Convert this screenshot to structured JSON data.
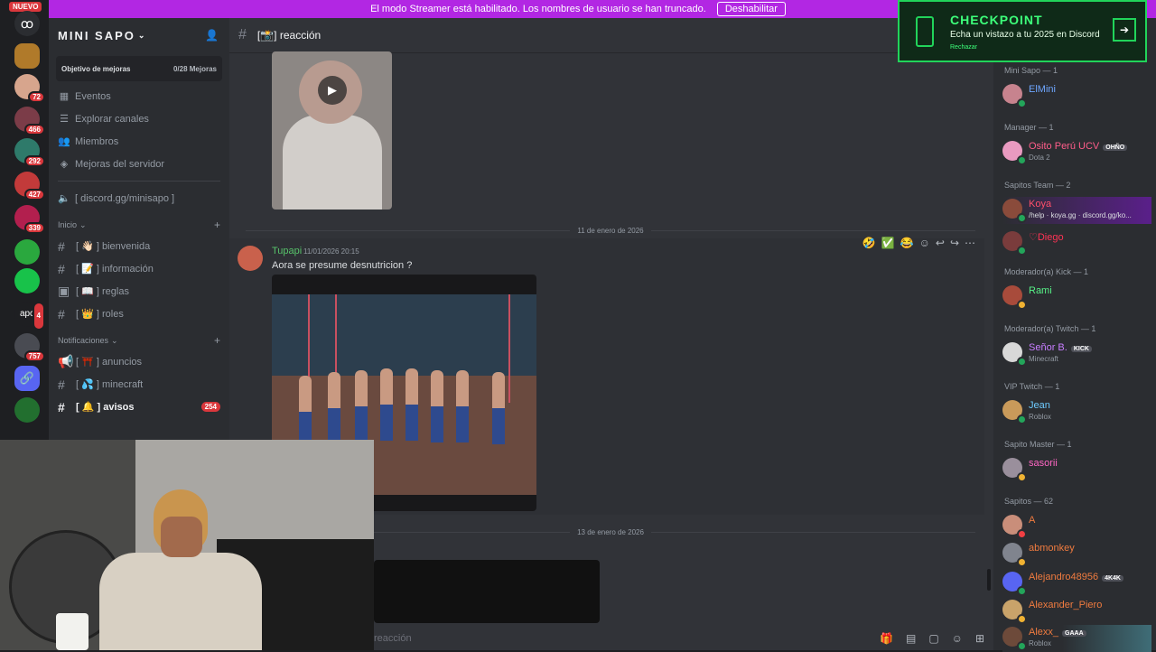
{
  "banner": {
    "text": "El modo Streamer está habilitado. Los nombres de usuario se han truncado.",
    "button": "Deshabilitar"
  },
  "guilds": {
    "new_badge": "NUEVO",
    "badges": [
      "72",
      "466",
      "292",
      "427",
      "339",
      "4",
      "757"
    ],
    "apc_label": "apc"
  },
  "server": {
    "name": "MINI SAPO",
    "boost_goal": "Objetivo de mejoras",
    "boost_count": "0/28 Mejoras",
    "nav": [
      "Eventos",
      "Explorar canales",
      "Miembros",
      "Mejoras del servidor"
    ],
    "invite_channel": "[ discord.gg/minisapo ]",
    "category_inicio": "Inicio",
    "category_notificaciones": "Notificaciones",
    "channels_inicio": [
      {
        "icon": "👋🏻",
        "name": "bienvenida"
      },
      {
        "icon": "📝",
        "name": "información"
      },
      {
        "icon": "📖",
        "name": "reglas"
      },
      {
        "icon": "👑",
        "name": "roles"
      }
    ],
    "channels_notif": [
      {
        "icon": "⛩️",
        "name": "anuncios"
      },
      {
        "icon": "💦",
        "name": "minecraft"
      },
      {
        "icon": "🔔",
        "name": "avisos",
        "mention": "254"
      }
    ]
  },
  "channel": {
    "name": "[📸] reacción",
    "date1": "11 de enero de 2026",
    "date2": "13 de enero de 2026",
    "message": {
      "author": "Tupapi",
      "time": "11/01/2026 20:15",
      "text": "Aora se presume desnutricion ?"
    },
    "composer_placeholder": "reacción"
  },
  "checkpoint": {
    "title": "CHECKPOINT",
    "subtitle": "Echa un vistazo a tu 2025 en Discord",
    "dismiss": "Rechazar"
  },
  "members": {
    "roles": [
      "Mini Sapo — 1",
      "Manager — 1",
      "Sapitos Team — 2",
      "Moderador(a) Kick — 1",
      "Moderador(a) Twitch — 1",
      "VIP Twitch — 1",
      "Sapito Master — 1",
      "Sapitos — 62"
    ],
    "list": [
      {
        "name": "ElMini",
        "color": "#6ea6ff",
        "activity": "",
        "tag": ""
      },
      {
        "name": "Osito Perú UCV",
        "color": "#ff5d8a",
        "activity": "Dota 2",
        "tag": "OHÑO"
      },
      {
        "name": "Koya",
        "color": "#ff4f6a",
        "activity": "/help · koya.gg · discord.gg/ko...",
        "tag": ""
      },
      {
        "name": "♡Diego",
        "color": "#ff3355",
        "activity": "",
        "tag": ""
      },
      {
        "name": "Rami",
        "color": "#57f287",
        "activity": "",
        "tag": ""
      },
      {
        "name": "Señor B.",
        "color": "#c77dff",
        "activity": "Minecraft",
        "tag": "KICK"
      },
      {
        "name": "Jean",
        "color": "#6ecbff",
        "activity": "Roblox",
        "tag": ""
      },
      {
        "name": "sasorii",
        "color": "#ff66c4",
        "activity": "",
        "tag": ""
      },
      {
        "name": "A",
        "color": "#f07b3f",
        "activity": "",
        "tag": ""
      },
      {
        "name": "abmonkey",
        "color": "#f07b3f",
        "activity": "",
        "tag": ""
      },
      {
        "name": "Alejandro48956",
        "color": "#f07b3f",
        "activity": "",
        "tag": "4K4K"
      },
      {
        "name": "Alexander_Piero",
        "color": "#f07b3f",
        "activity": "",
        "tag": ""
      },
      {
        "name": "Alexx_",
        "color": "#f07b3f",
        "activity": "Roblox",
        "tag": "GAAA"
      }
    ]
  }
}
